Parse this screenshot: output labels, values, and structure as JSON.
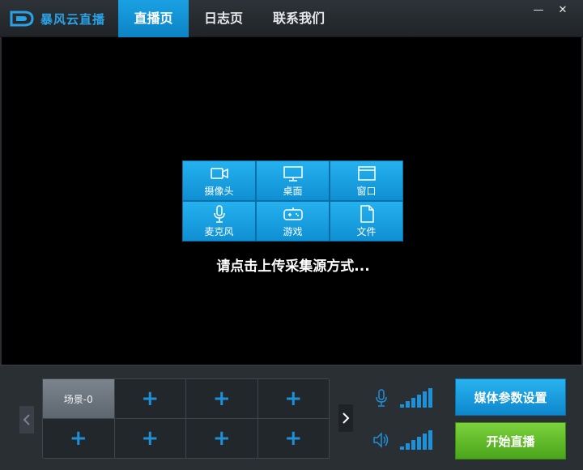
{
  "app": {
    "name": "暴风云直播"
  },
  "nav": {
    "tabs": [
      {
        "label": "直播页",
        "active": true
      },
      {
        "label": "日志页",
        "active": false
      },
      {
        "label": "联系我们",
        "active": false
      }
    ]
  },
  "window": {
    "minimize": "—",
    "close": "✕"
  },
  "sources": {
    "items": [
      {
        "label": "摄像头",
        "icon": "camera-icon"
      },
      {
        "label": "桌面",
        "icon": "monitor-icon"
      },
      {
        "label": "窗口",
        "icon": "window-icon"
      },
      {
        "label": "麦克风",
        "icon": "microphone-icon"
      },
      {
        "label": "游戏",
        "icon": "gamepad-icon"
      },
      {
        "label": "文件",
        "icon": "file-icon"
      }
    ],
    "hint": "请点击上传采集源方式..."
  },
  "scenes": {
    "active_label": "场景-0",
    "add_glyph": "+"
  },
  "buttons": {
    "media_settings": "媒体参数设置",
    "start_live": "开始直播"
  },
  "colors": {
    "accent": "#1aa1e3",
    "start": "#5cb82a",
    "background": "#000000"
  }
}
